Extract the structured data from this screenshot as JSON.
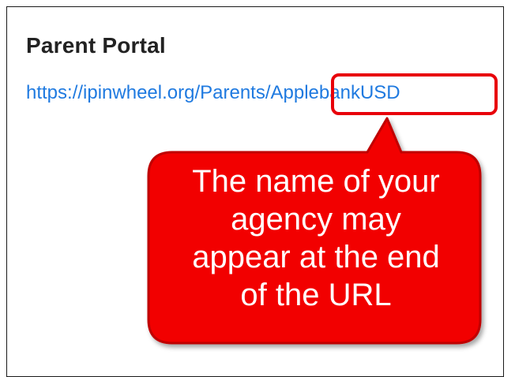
{
  "section": {
    "title": "Parent Portal"
  },
  "portal_link": {
    "base": "https://ipinwheel.org/Parents/",
    "agency": "ApplebankUSD"
  },
  "callout": {
    "text": "The name of your\nagency may\nappear at the end\nof the URL"
  },
  "colors": {
    "link": "#1f7ae0",
    "callout_fill": "#f20000",
    "callout_border": "#c00000",
    "highlight_border": "#e8000a"
  }
}
